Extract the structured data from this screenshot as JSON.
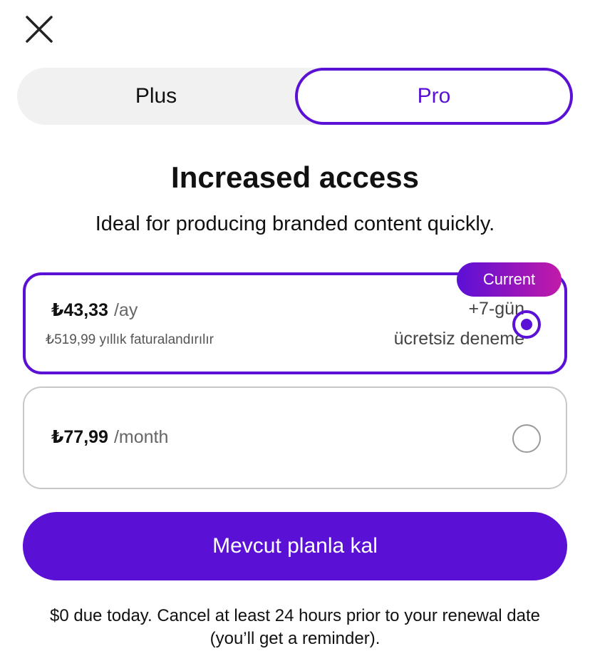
{
  "icons": {
    "close": "close-icon"
  },
  "tabs": [
    {
      "label": "Plus",
      "selected": false
    },
    {
      "label": "Pro",
      "selected": true
    }
  ],
  "header": {
    "title": "Increased access",
    "subtitle": "Ideal for producing branded content quickly."
  },
  "plans": [
    {
      "badge": "Current",
      "price": "₺43,33",
      "period": "/ay",
      "billed": "₺519,99 yıllık faturalandırılır",
      "trial_line1": "+7-gün",
      "trial_line2": "ücretsiz deneme",
      "selected": true
    },
    {
      "price": "₺77,99",
      "period": "/month",
      "selected": false
    }
  ],
  "cta": {
    "label": "Mevcut planla kal"
  },
  "footer": {
    "text": "$0 due today. Cancel at least 24 hours prior to your renewal date (you’ll get a reminder)."
  },
  "colors": {
    "accent": "#5b10d6",
    "badge_gradient_end": "#c21aa8",
    "tab_bg": "#f1f1f1"
  }
}
